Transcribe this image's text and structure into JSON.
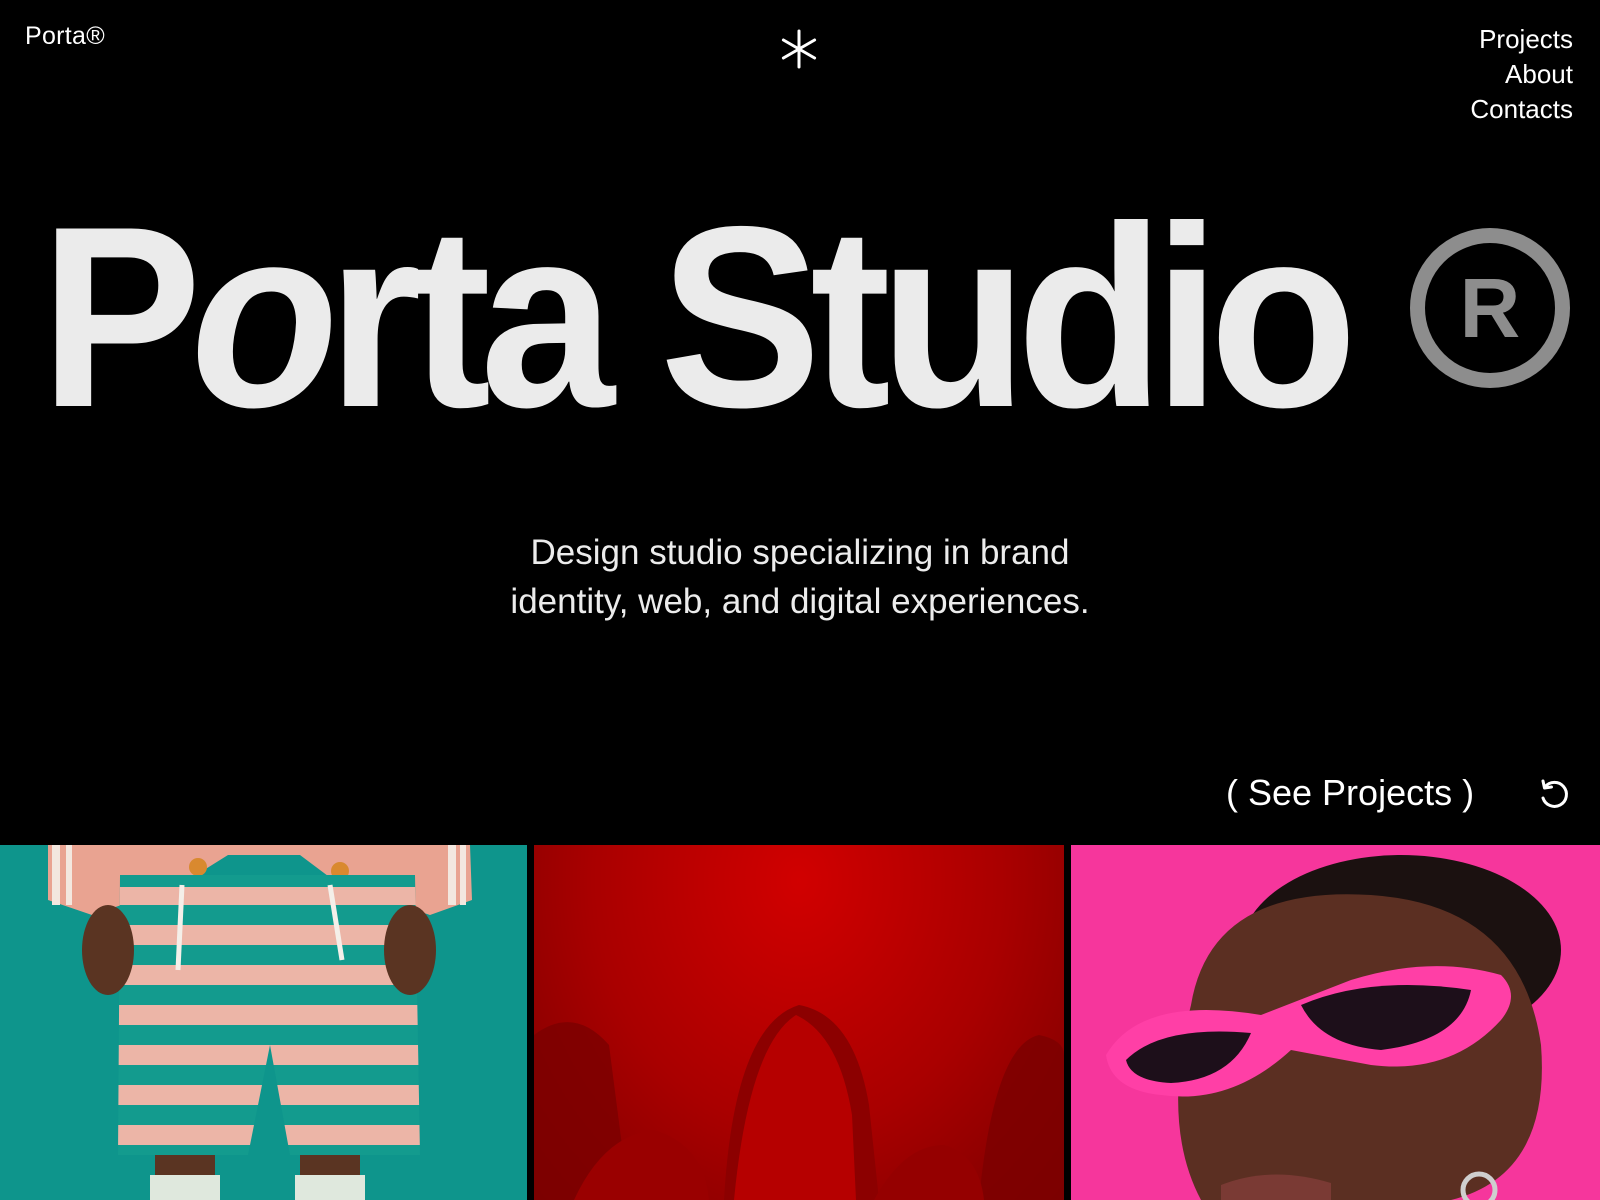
{
  "header": {
    "brand": "Porta®",
    "nav": [
      {
        "label": "Projects"
      },
      {
        "label": "About"
      },
      {
        "label": "Contacts"
      }
    ]
  },
  "hero": {
    "title_pre": "P",
    "title_o": "o",
    "title_post": "rta Studio",
    "reg_symbol": "R",
    "tagline_line1": "Design studio specializing in brand",
    "tagline_line2": "identity, web, and digital experiences."
  },
  "cta": {
    "see_projects": "( See Projects )"
  },
  "icons": {
    "logo": "asterisk-icon",
    "refresh": "refresh-icon"
  },
  "gallery": {
    "tiles": [
      {
        "subject": "striped-shorts-photo",
        "bg": "#0e958c"
      },
      {
        "subject": "red-hooded-figures-photo",
        "bg": "#b00000"
      },
      {
        "subject": "pink-sunglasses-portrait-photo",
        "bg": "#f6369c"
      }
    ]
  },
  "colors": {
    "background": "#000000",
    "title": "#ebebeb",
    "reg_mark": "#8d8d8d",
    "text": "#ffffff"
  }
}
